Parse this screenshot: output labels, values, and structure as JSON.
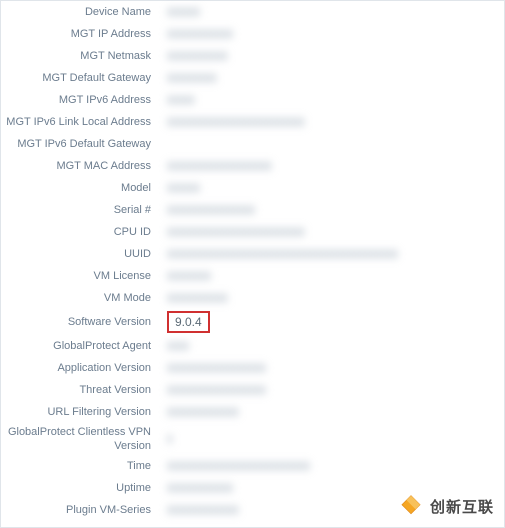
{
  "rows": [
    {
      "label": "Device Name",
      "value": "xxxxxx",
      "blurred": true,
      "highlight": false
    },
    {
      "label": "MGT IP Address",
      "value": "xxxxxxxxxxxx",
      "blurred": true,
      "highlight": false
    },
    {
      "label": "MGT Netmask",
      "value": "xxxxxxxxxxx",
      "blurred": true,
      "highlight": false
    },
    {
      "label": "MGT Default Gateway",
      "value": "xxxxxxxxx",
      "blurred": true,
      "highlight": false
    },
    {
      "label": "MGT IPv6 Address",
      "value": "xxxxx",
      "blurred": true,
      "highlight": false
    },
    {
      "label": "MGT IPv6 Link Local Address",
      "value": "xxxxxxxxxxxxxxxxxxxxxxxxx",
      "blurred": true,
      "highlight": false
    },
    {
      "label": "MGT IPv6 Default Gateway",
      "value": "",
      "blurred": false,
      "highlight": false
    },
    {
      "label": "MGT MAC Address",
      "value": "xxxxxxxxxxxxxxxxxxx",
      "blurred": true,
      "highlight": false
    },
    {
      "label": "Model",
      "value": "xxxxxx",
      "blurred": true,
      "highlight": false
    },
    {
      "label": "Serial #",
      "value": "xxxxxxxxxxxxxxxx",
      "blurred": true,
      "highlight": false
    },
    {
      "label": "CPU ID",
      "value": "xxxxxxxxxxxxxxxxxxxxxxxxx",
      "blurred": true,
      "highlight": false
    },
    {
      "label": "UUID",
      "value": "xxxxxxxxxxxxxxxxxxxxxxxxxxxxxxxxxxxxxxxxxx",
      "blurred": true,
      "highlight": false
    },
    {
      "label": "VM License",
      "value": "xxxxxxxx",
      "blurred": true,
      "highlight": false
    },
    {
      "label": "VM Mode",
      "value": "xxxxxxxxxxx",
      "blurred": true,
      "highlight": false
    },
    {
      "label": "Software Version",
      "value": "9.0.4",
      "blurred": false,
      "highlight": true
    },
    {
      "label": "GlobalProtect Agent",
      "value": "xxxx",
      "blurred": true,
      "highlight": false
    },
    {
      "label": "Application Version",
      "value": "xxxxxxxxxxxxxxxxxx",
      "blurred": true,
      "highlight": false
    },
    {
      "label": "Threat Version",
      "value": "xxxxxxxxxxxxxxxxxx",
      "blurred": true,
      "highlight": false
    },
    {
      "label": "URL Filtering Version",
      "value": "xxxxxxxxxxxxx",
      "blurred": true,
      "highlight": false
    },
    {
      "label": "GlobalProtect Clientless VPN Version",
      "value": "x",
      "blurred": true,
      "highlight": false
    },
    {
      "label": "Time",
      "value": "xxxxxxxxxxxxxxxxxxxxxxxxxx",
      "blurred": true,
      "highlight": false
    },
    {
      "label": "Uptime",
      "value": "xxxxxxxxxxxx",
      "blurred": true,
      "highlight": false
    },
    {
      "label": "Plugin VM-Series",
      "value": "xxxxxxxxxxxxx",
      "blurred": true,
      "highlight": false
    }
  ],
  "branding": {
    "text": "创新互联"
  }
}
